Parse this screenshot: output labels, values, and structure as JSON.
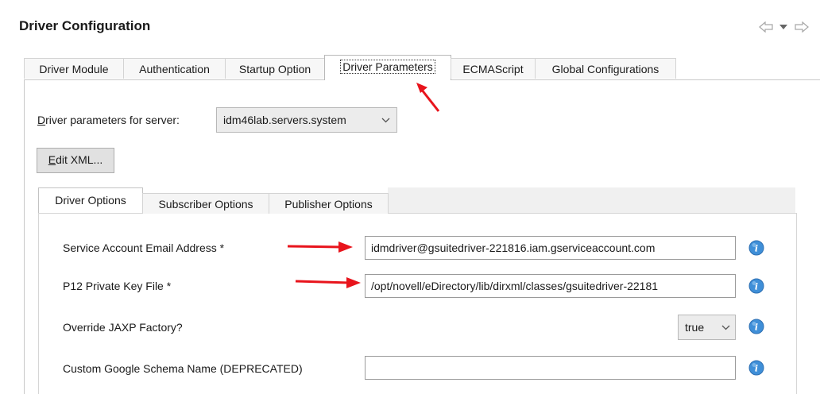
{
  "header": {
    "title": "Driver Configuration"
  },
  "outer_tabs": [
    {
      "label": "Driver Module"
    },
    {
      "label": "Authentication"
    },
    {
      "label": "Startup Option"
    },
    {
      "label": "Driver Parameters",
      "active": true
    },
    {
      "label": "ECMAScript"
    },
    {
      "label": "Global Configurations"
    }
  ],
  "server": {
    "label_mnemonic": "D",
    "label_rest": "river parameters for server:",
    "selected": "idm46lab.servers.system"
  },
  "edit_xml": {
    "mnemonic": "E",
    "rest": "dit XML..."
  },
  "inner_tabs": [
    {
      "label": "Driver Options",
      "active": true
    },
    {
      "label": "Subscriber Options"
    },
    {
      "label": "Publisher Options"
    }
  ],
  "fields": [
    {
      "label": "Service Account Email Address *",
      "value": "idmdriver@gsuitedriver-221816.iam.gserviceaccount.com"
    },
    {
      "label": "P12 Private Key File *",
      "value": "/opt/novell/eDirectory/lib/dirxml/classes/gsuitedriver-22181"
    },
    {
      "label": "Override JAXP Factory?",
      "value": "true"
    },
    {
      "label": "Custom Google Schema Name (DEPRECATED)",
      "value": ""
    }
  ],
  "icons": {
    "back": "back-arrow-icon",
    "menu": "view-menu-icon",
    "forward": "forward-arrow-icon",
    "info": "info-icon",
    "annotation": "red-arrow-annotation"
  },
  "colors": {
    "annotation_red": "#e8141c",
    "info_blue": "#3f8fd8",
    "tab_border": "#d4d4d4"
  }
}
